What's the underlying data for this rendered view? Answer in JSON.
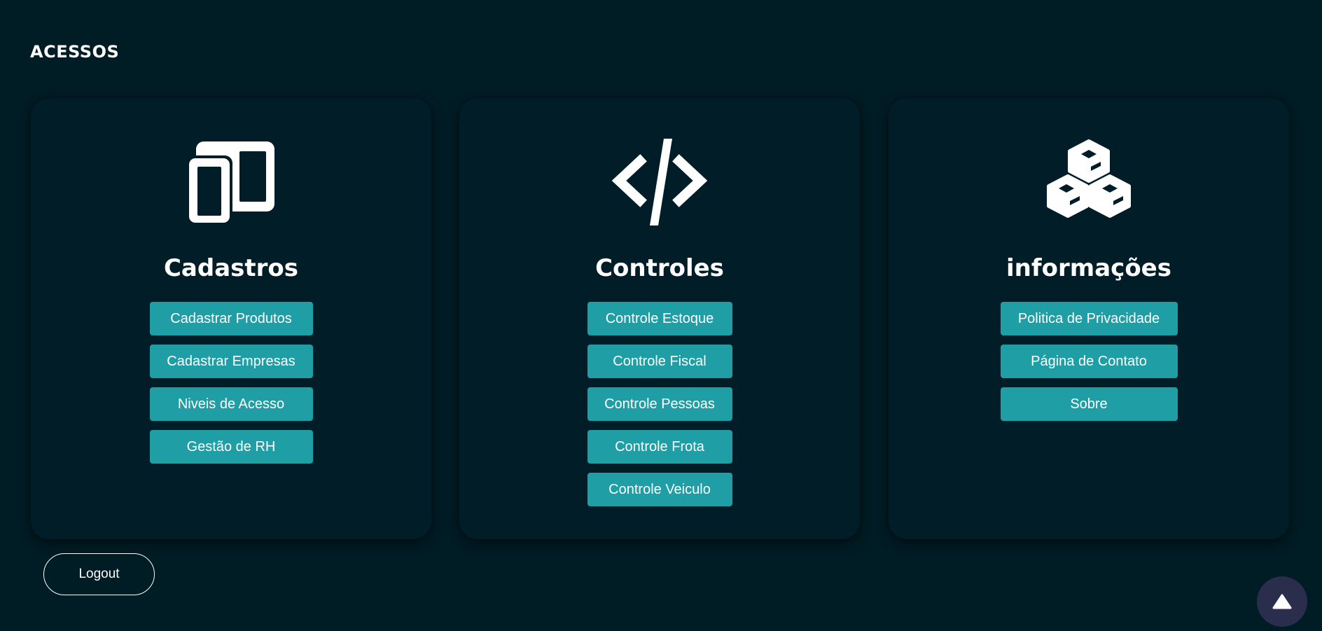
{
  "section": {
    "title": "ACESSOS"
  },
  "cards": [
    {
      "icon": "tablet-devices-icon",
      "title": "Cadastros",
      "buttons": [
        "Cadastrar Produtos",
        "Cadastrar Empresas",
        "Niveis de Acesso",
        "Gestão de RH"
      ]
    },
    {
      "icon": "code-icon",
      "title": "Controles",
      "buttons": [
        "Controle Estoque",
        "Controle Fiscal",
        "Controle Pessoas",
        "Controle Frota",
        "Controle Veiculo"
      ]
    },
    {
      "icon": "cubes-icon",
      "title": "informações",
      "buttons": [
        "Politica de Privacidade",
        "Página de Contato",
        "Sobre"
      ]
    }
  ],
  "logout_label": "Logout",
  "back_to_top_icon": "arrow-up-icon",
  "colors": {
    "background": "#001c25",
    "card": "#011d27",
    "button": "#1f9ea5",
    "back_to_top": "#2b2d4c",
    "text": "#ffffff"
  }
}
